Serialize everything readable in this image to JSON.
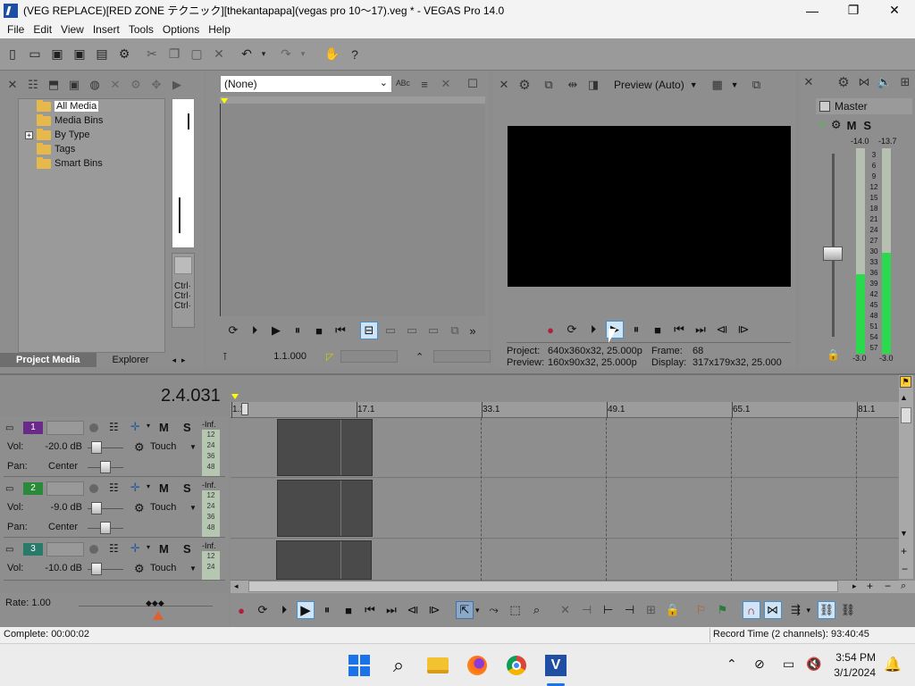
{
  "window": {
    "title": "(VEG REPLACE)[RED ZONE テクニック][thekantapapa](vegas pro 10〜17).veg * - VEGAS Pro 14.0",
    "minimize": "—",
    "maximize": "❐",
    "close": "✕"
  },
  "menu": {
    "file": "File",
    "edit": "Edit",
    "view": "View",
    "insert": "Insert",
    "tools": "Tools",
    "options": "Options",
    "help": "Help"
  },
  "project_media": {
    "tree": {
      "all_media": "All Media",
      "media_bins": "Media Bins",
      "by_type": "By Type",
      "tags": "Tags",
      "smart_bins": "Smart Bins"
    },
    "tabs": {
      "project_media": "Project Media",
      "explorer": "Explorer"
    },
    "ctrl_labels": [
      "Ctrl·",
      "Ctrl·",
      "Ctrl·"
    ]
  },
  "trimmer": {
    "dropdown_value": "(None)",
    "time": "1.1.000"
  },
  "preview": {
    "mode": "Preview (Auto)",
    "info": {
      "project_label": "Project:",
      "project_value": "640x360x32, 25.000p",
      "preview_label": "Preview:",
      "preview_value": "160x90x32, 25.000p",
      "frame_label": "Frame:",
      "frame_value": "68",
      "display_label": "Display:",
      "display_value": "317x179x32, 25.000"
    }
  },
  "master": {
    "title": "Master",
    "mute": "M",
    "solo": "S",
    "peak_left": "-14.0",
    "peak_right": "-13.7",
    "scale": [
      "3",
      "6",
      "9",
      "12",
      "15",
      "18",
      "21",
      "24",
      "27",
      "30",
      "33",
      "36",
      "39",
      "42",
      "45",
      "48",
      "51",
      "54",
      "57"
    ],
    "level_left": "-3.0",
    "level_right": "-3.0"
  },
  "timeline": {
    "cursor_time": "2.4.031",
    "ruler": [
      "1.1",
      "17.1",
      "33.1",
      "49.1",
      "65.1",
      "81.1"
    ],
    "tracks": [
      {
        "num": "1",
        "vol_label": "Vol:",
        "vol": "-20.0 dB",
        "pan_label": "Pan:",
        "pan": "Center",
        "mode": "Touch",
        "m": "M",
        "s": "S",
        "inf": "-Inf.",
        "meter": [
          "12",
          "24",
          "36",
          "48"
        ],
        "color": "#6a2a8a"
      },
      {
        "num": "2",
        "vol_label": "Vol:",
        "vol": "-9.0 dB",
        "pan_label": "Pan:",
        "pan": "Center",
        "mode": "Touch",
        "m": "M",
        "s": "S",
        "inf": "-Inf.",
        "meter": [
          "12",
          "24",
          "36",
          "48"
        ],
        "color": "#2a8a3a"
      },
      {
        "num": "3",
        "vol_label": "Vol:",
        "vol": "-10.0 dB",
        "mode": "Touch",
        "m": "M",
        "s": "S",
        "inf": "-Inf.",
        "meter": [
          "12",
          "24"
        ],
        "color": "#2a7a6a"
      }
    ],
    "rate": "Rate: 1.00"
  },
  "status": {
    "complete": "Complete: 00:00:02",
    "record_time": "Record Time (2 channels): 93:40:45"
  },
  "taskbar": {
    "time": "3:54 PM",
    "date": "3/1/2024"
  }
}
